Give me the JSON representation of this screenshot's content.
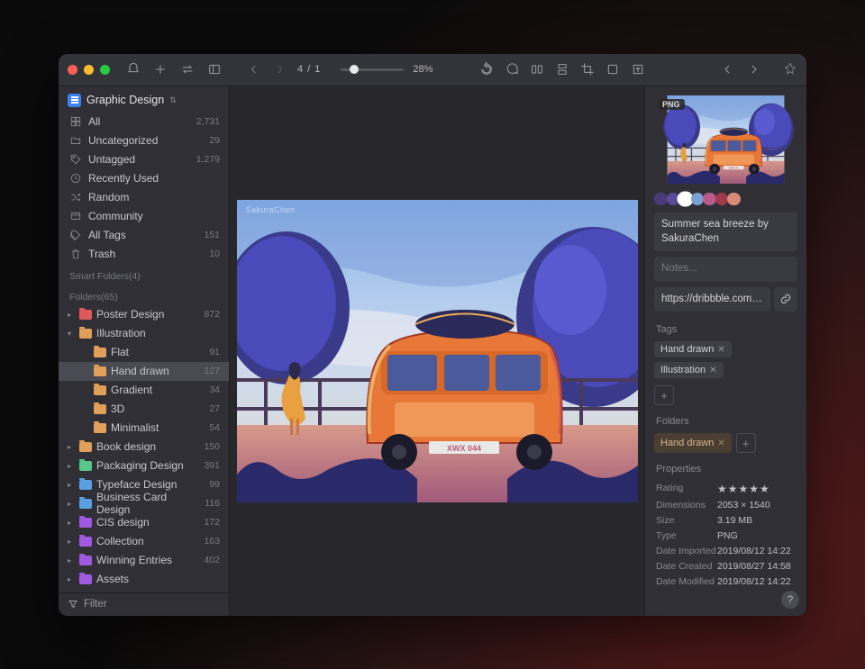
{
  "library": {
    "name": "Graphic Design"
  },
  "pager": {
    "text": "4 / 1"
  },
  "zoom": {
    "pct": "28%"
  },
  "fixedItems": [
    {
      "icon": "all",
      "label": "All",
      "count": "2,731"
    },
    {
      "icon": "uncat",
      "label": "Uncategorized",
      "count": "29"
    },
    {
      "icon": "untag",
      "label": "Untagged",
      "count": "1,279"
    },
    {
      "icon": "recent",
      "label": "Recently Used",
      "count": ""
    },
    {
      "icon": "random",
      "label": "Random",
      "count": ""
    },
    {
      "icon": "comm",
      "label": "Community",
      "count": ""
    },
    {
      "icon": "tags",
      "label": "All Tags",
      "count": "151"
    },
    {
      "icon": "trash",
      "label": "Trash",
      "count": "10"
    }
  ],
  "smartFoldersLabel": "Smart Folders(4)",
  "foldersLabel": "Folders(65)",
  "folders": [
    {
      "name": "Poster Design",
      "count": "872",
      "color": "#e05a5a",
      "depth": 0,
      "expanded": false,
      "hasChildren": true
    },
    {
      "name": "Illustration",
      "count": "",
      "color": "#e0a05a",
      "depth": 0,
      "expanded": true,
      "hasChildren": true
    },
    {
      "name": "Flat",
      "count": "91",
      "color": "#e0a05a",
      "depth": 1
    },
    {
      "name": "Hand drawn",
      "count": "127",
      "color": "#e0a05a",
      "depth": 1,
      "selected": true
    },
    {
      "name": "Gradient",
      "count": "34",
      "color": "#e0a05a",
      "depth": 1
    },
    {
      "name": "3D",
      "count": "27",
      "color": "#e0a05a",
      "depth": 1
    },
    {
      "name": "Minimalist",
      "count": "54",
      "color": "#e0a05a",
      "depth": 1
    },
    {
      "name": "Book design",
      "count": "150",
      "color": "#e0a05a",
      "depth": 0,
      "hasChildren": true
    },
    {
      "name": "Packaging Design",
      "count": "391",
      "color": "#5ac78a",
      "depth": 0,
      "hasChildren": true
    },
    {
      "name": "Typeface Design",
      "count": "99",
      "color": "#5aa0e0",
      "depth": 0,
      "hasChildren": true
    },
    {
      "name": "Business Card Design",
      "count": "116",
      "color": "#5aa0e0",
      "depth": 0,
      "hasChildren": true
    },
    {
      "name": "CIS design",
      "count": "172",
      "color": "#a05ae0",
      "depth": 0,
      "hasChildren": true
    },
    {
      "name": "Collection",
      "count": "163",
      "color": "#a05ae0",
      "depth": 0,
      "hasChildren": true
    },
    {
      "name": "Winning Entries",
      "count": "402",
      "color": "#a05ae0",
      "depth": 0,
      "hasChildren": true
    },
    {
      "name": "Assets",
      "count": "",
      "color": "#a05ae0",
      "depth": 0,
      "hasChildren": true
    }
  ],
  "filterLabel": "Filter",
  "asset": {
    "badge": "PNG",
    "title": "Summer sea breeze by SakuraChen",
    "notesPlaceholder": "Notes...",
    "url": "https://dribbble.com/sakurac",
    "watermark": "SakuraChen"
  },
  "swatches": [
    "#4a3b78",
    "#5a4a9a",
    "#ffffff",
    "#7aa0d8",
    "#b85a8a",
    "#a03a4a",
    "#d88a78"
  ],
  "tagsLabel": "Tags",
  "tags": [
    "Hand drawn",
    "Illustration"
  ],
  "foldersPanelLabel": "Folders",
  "assetFolders": [
    "Hand drawn"
  ],
  "propsLabel": "Properties",
  "props": {
    "rating": 5,
    "dimensions": "2053 × 1540",
    "size": "3.19 MB",
    "type": "PNG",
    "imported": "2019/08/12 14:22",
    "created": "2019/08/27 14:58",
    "modified": "2019/08/12 14:22"
  },
  "propLabels": {
    "rating": "Rating",
    "dimensions": "Dimensions",
    "size": "Size",
    "type": "Type",
    "imported": "Date Imported",
    "created": "Date Created",
    "modified": "Date Modified"
  }
}
